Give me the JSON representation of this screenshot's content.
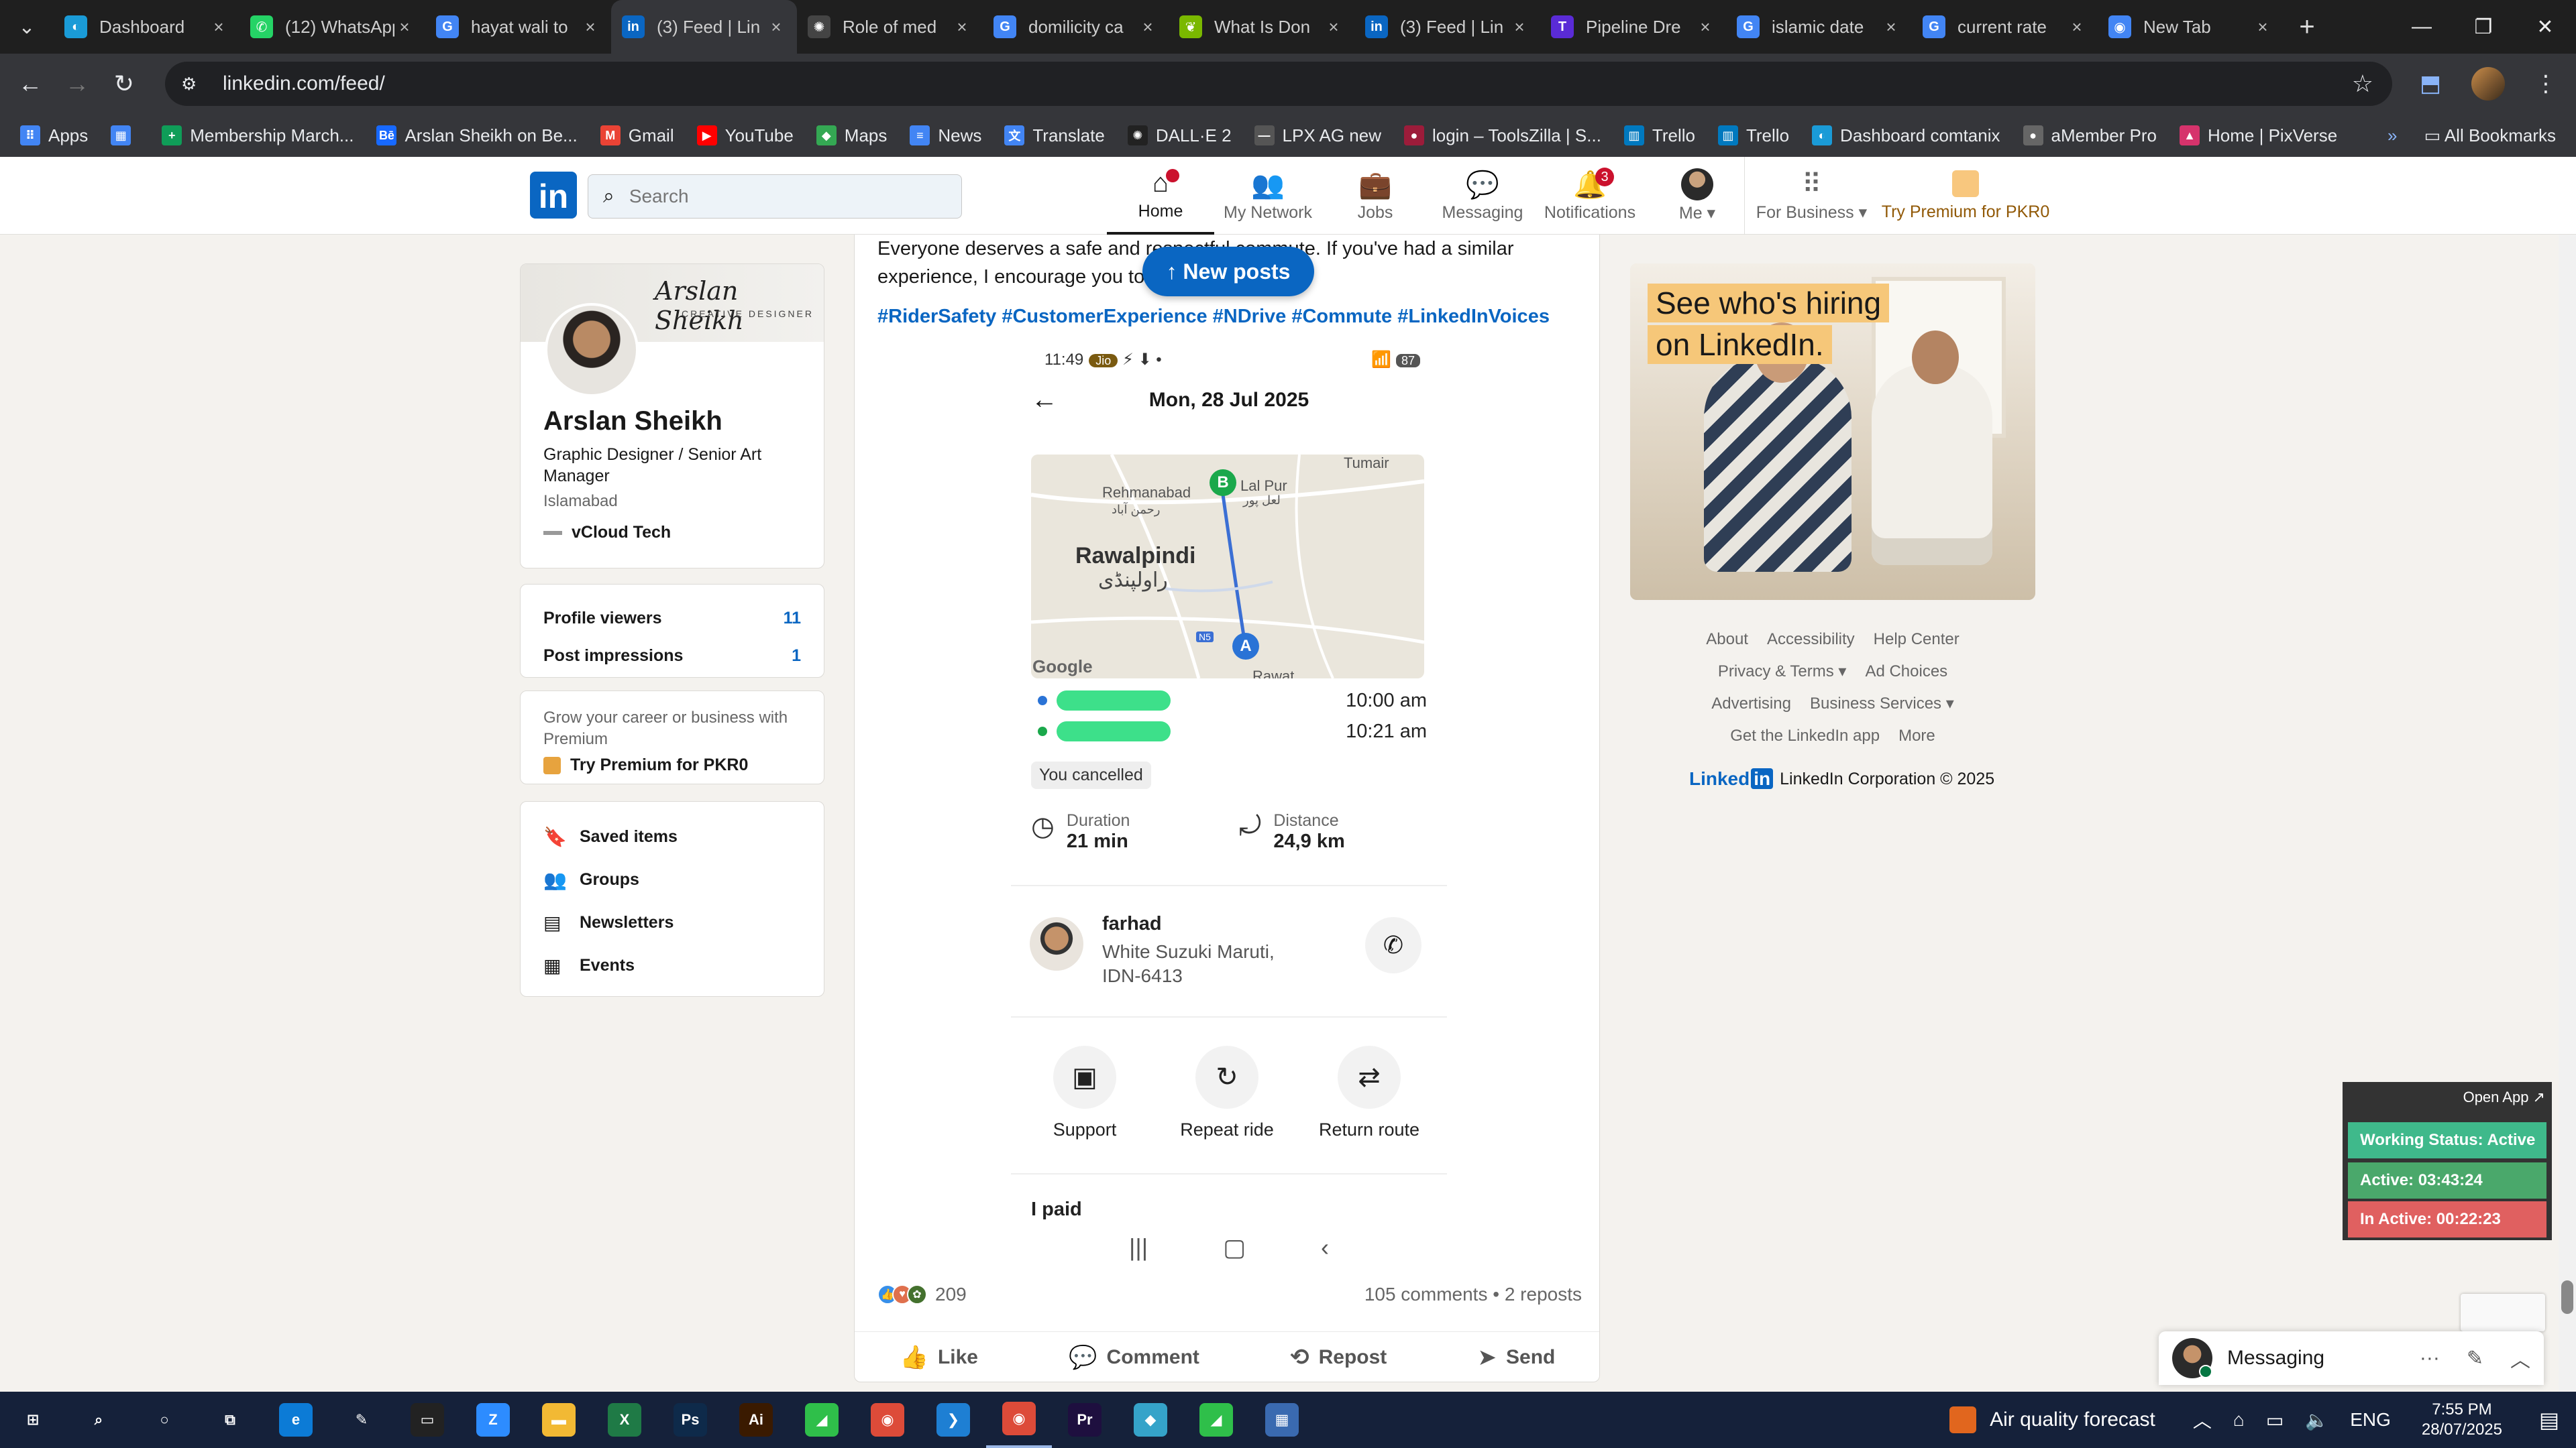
{
  "browser": {
    "tabs": [
      {
        "title": "Dashboard",
        "icon": "dashboard-icon",
        "color": "#1a9bd7",
        "glyph": "◐"
      },
      {
        "title": "(12) WhatsApp",
        "icon": "whatsapp-icon",
        "color": "#25d366",
        "glyph": "✆"
      },
      {
        "title": "hayat wali to",
        "icon": "google-icon",
        "color": "#4285f4",
        "glyph": "G"
      },
      {
        "title": "(3) Feed | Lin",
        "icon": "linkedin-icon",
        "color": "#0a66c2",
        "glyph": "in"
      },
      {
        "title": "Role of med",
        "icon": "openai-icon",
        "color": "#444444",
        "glyph": "✺"
      },
      {
        "title": "domilicity ca",
        "icon": "google-icon",
        "color": "#4285f4",
        "glyph": "G"
      },
      {
        "title": "What Is Don",
        "icon": "leaf-icon",
        "color": "#7ab800",
        "glyph": "❦"
      },
      {
        "title": "(3) Feed | Lin",
        "icon": "linkedin-icon",
        "color": "#0a66c2",
        "glyph": "in"
      },
      {
        "title": "Pipeline Dre",
        "icon": "t-brand-icon",
        "color": "#5a2bd6",
        "glyph": "T"
      },
      {
        "title": "islamic date",
        "icon": "google-icon",
        "color": "#4285f4",
        "glyph": "G"
      },
      {
        "title": "current rate",
        "icon": "google-icon",
        "color": "#4285f4",
        "glyph": "G"
      },
      {
        "title": "New Tab",
        "icon": "chrome-icon",
        "color": "#4285f4",
        "glyph": "◉"
      }
    ],
    "url": "linkedin.com/feed/",
    "bookmarks": [
      {
        "label": "Apps",
        "icon": "apps-grid-icon",
        "color": "#4285f4",
        "glyph": "⠿"
      },
      {
        "label": "",
        "icon": "tab-groups-icon",
        "color": "#4285f4",
        "glyph": "▦"
      },
      {
        "label": "Membership March...",
        "icon": "plus-doc-icon",
        "color": "#0f9d58",
        "glyph": "+"
      },
      {
        "label": "Arslan Sheikh on Be...",
        "icon": "behance-icon",
        "color": "#1769ff",
        "glyph": "Bē"
      },
      {
        "label": "Gmail",
        "icon": "gmail-icon",
        "color": "#ea4335",
        "glyph": "M"
      },
      {
        "label": "YouTube",
        "icon": "youtube-icon",
        "color": "#ff0000",
        "glyph": "▶"
      },
      {
        "label": "Maps",
        "icon": "maps-icon",
        "color": "#34a853",
        "glyph": "◆"
      },
      {
        "label": "News",
        "icon": "news-icon",
        "color": "#4285f4",
        "glyph": "≡"
      },
      {
        "label": "Translate",
        "icon": "translate-icon",
        "color": "#4285f4",
        "glyph": "文"
      },
      {
        "label": "DALL·E 2",
        "icon": "openai-icon",
        "color": "#222222",
        "glyph": "✺"
      },
      {
        "label": "LPX AG new",
        "icon": "dash-icon",
        "color": "#555555",
        "glyph": "—"
      },
      {
        "label": "login – ToolsZilla | S...",
        "icon": "toolszilla-icon",
        "color": "#9c1c3a",
        "glyph": "●"
      },
      {
        "label": "Trello",
        "icon": "trello-icon",
        "color": "#0079bf",
        "glyph": "▥"
      },
      {
        "label": "Trello",
        "icon": "trello-icon",
        "color": "#0079bf",
        "glyph": "▥"
      },
      {
        "label": "Dashboard comtanix",
        "icon": "dashboard-icon",
        "color": "#1a9bd7",
        "glyph": "◐"
      },
      {
        "label": "aMember Pro",
        "icon": "amember-icon",
        "color": "#666666",
        "glyph": "●"
      },
      {
        "label": "Home | PixVerse",
        "icon": "pixverse-icon",
        "color": "#d6336c",
        "glyph": "▲"
      }
    ],
    "all_bookmarks": "All Bookmarks"
  },
  "linkedin": {
    "search_placeholder": "Search",
    "nav": [
      {
        "label": "Home",
        "icon": "home-icon",
        "glyph": "⌂",
        "badge": "",
        "active": true
      },
      {
        "label": "My Network",
        "icon": "network-icon",
        "glyph": "👥",
        "badge": "",
        "active": false
      },
      {
        "label": "Jobs",
        "icon": "briefcase-icon",
        "glyph": "💼",
        "badge": "",
        "active": false
      },
      {
        "label": "Messaging",
        "icon": "chat-icon",
        "glyph": "💬",
        "badge": "",
        "active": false
      },
      {
        "label": "Notifications",
        "icon": "bell-icon",
        "glyph": "🔔",
        "badge": "3",
        "active": false
      }
    ],
    "me_label": "Me ▾",
    "for_business": "For Business ▾",
    "try_premium": "Try Premium for PKR0"
  },
  "profile": {
    "cover_signature": "Arslan Sheikh",
    "cover_subtitle": "CREATIVE DESIGNER",
    "name": "Arslan Sheikh",
    "headline": "Graphic Designer / Senior Art Manager",
    "location": "Islamabad",
    "company": "vCloud Tech",
    "stats": [
      {
        "label": "Profile viewers",
        "value": "11"
      },
      {
        "label": "Post impressions",
        "value": "1"
      }
    ],
    "premium_text": "Grow your career or business with Premium",
    "premium_link": "Try Premium for PKR0",
    "shortcuts": [
      {
        "label": "Saved items",
        "icon": "bookmark-icon",
        "glyph": "🔖"
      },
      {
        "label": "Groups",
        "icon": "groups-icon",
        "glyph": "👥"
      },
      {
        "label": "Newsletters",
        "icon": "newsletter-icon",
        "glyph": "▤"
      },
      {
        "label": "Events",
        "icon": "calendar-icon",
        "glyph": "▦"
      }
    ]
  },
  "post": {
    "text": "Everyone deserves a safe and respectful commute. If you've had a similar experience, I encourage you to speak up. We",
    "hashtags": "#RiderSafety #CustomerExperience #NDrive #Commute #LinkedInVoices",
    "new_posts": "↑ New posts",
    "screenshot": {
      "time": "11:49",
      "carrier": "Jio",
      "battery": "87",
      "title": "Mon, 28 Jul 2025",
      "map_city": "Rawalpindi",
      "map_city_urdu": "راولپنڈی",
      "map_labels": [
        "Rehmanabad",
        "رحمن آباد",
        "Lal Pur",
        "لعل پور",
        "Tumair",
        "Rawat",
        "N5"
      ],
      "pin_b": "B",
      "pin_a": "A",
      "google": "Google",
      "pickup_time": "10:00 am",
      "dropoff_time": "10:21 am",
      "cancel_status": "You cancelled",
      "duration_label": "Duration",
      "duration_value": "21 min",
      "distance_label": "Distance",
      "distance_value": "24,9 km",
      "driver_name": "farhad",
      "driver_car": "White Suzuki Maruti, IDN-6413",
      "actions": [
        {
          "label": "Support",
          "icon": "support-chat-icon",
          "glyph": "▣"
        },
        {
          "label": "Repeat ride",
          "icon": "repeat-icon",
          "glyph": "↻"
        },
        {
          "label": "Return route",
          "icon": "swap-icon",
          "glyph": "⇄"
        }
      ],
      "paid": "I paid"
    },
    "reactions_count": "209",
    "comments_reposts": "105 comments • 2 reposts",
    "actions": [
      {
        "label": "Like",
        "icon": "thumbs-up-icon",
        "glyph": "👍"
      },
      {
        "label": "Comment",
        "icon": "comment-icon",
        "glyph": "💬"
      },
      {
        "label": "Repost",
        "icon": "repost-icon",
        "glyph": "⟲"
      },
      {
        "label": "Send",
        "icon": "send-icon",
        "glyph": "➤"
      }
    ]
  },
  "ad": {
    "line1": "See who's hiring",
    "line2": "on LinkedIn."
  },
  "footer": {
    "links": [
      "About",
      "Accessibility",
      "Help Center",
      "Privacy & Terms ▾",
      "Ad Choices",
      "Advertising",
      "Business Services ▾",
      "Get the LinkedIn app",
      "More"
    ],
    "brand": "Linked",
    "brand_in": "in",
    "copyright": "LinkedIn Corporation © 2025"
  },
  "tracker": {
    "open_app": "Open App ↗",
    "working_status": "Working Status: Active",
    "active": "Active: 03:43:24",
    "inactive": "In Active: 00:22:23"
  },
  "messaging": {
    "title": "Messaging"
  },
  "taskbar": {
    "weather": "Air quality forecast",
    "lang": "ENG",
    "time": "7:55 PM",
    "date": "28/07/2025",
    "apps": [
      {
        "icon": "windows-start-icon",
        "glyph": "⊞",
        "color": "transparent"
      },
      {
        "icon": "search-icon",
        "glyph": "⌕",
        "color": "transparent"
      },
      {
        "icon": "cortana-icon",
        "glyph": "○",
        "color": "transparent"
      },
      {
        "icon": "task-view-icon",
        "glyph": "⧉",
        "color": "transparent"
      },
      {
        "icon": "edge-icon",
        "glyph": "e",
        "color": "#0c7bd6"
      },
      {
        "icon": "pen-icon",
        "glyph": "✎",
        "color": "transparent"
      },
      {
        "icon": "terminal-icon",
        "glyph": "▭",
        "color": "#222222"
      },
      {
        "icon": "zoom-icon",
        "glyph": "Z",
        "color": "#2d8cff"
      },
      {
        "icon": "file-explorer-icon",
        "glyph": "▬",
        "color": "#f2b934"
      },
      {
        "icon": "excel-icon",
        "glyph": "X",
        "color": "#1f7a46"
      },
      {
        "icon": "photoshop-icon",
        "glyph": "Ps",
        "color": "#0e2a4a"
      },
      {
        "icon": "illustrator-icon",
        "glyph": "Ai",
        "color": "#3a1a00"
      },
      {
        "icon": "green-app-icon",
        "glyph": "◢",
        "color": "#2fbf4a"
      },
      {
        "icon": "chrome-icon",
        "glyph": "◉",
        "color": "#dd4b39"
      },
      {
        "icon": "vscode-icon",
        "glyph": "❯",
        "color": "#1e7fd3"
      },
      {
        "icon": "chrome-icon",
        "glyph": "◉",
        "color": "#dd4b39"
      },
      {
        "icon": "premiere-icon",
        "glyph": "Pr",
        "color": "#1e0f3f"
      },
      {
        "icon": "blue-app-icon",
        "glyph": "◆",
        "color": "#35a3c9"
      },
      {
        "icon": "green-app-icon",
        "glyph": "◢",
        "color": "#2fbf4a"
      },
      {
        "icon": "calculator-icon",
        "glyph": "▦",
        "color": "#3a6ab0"
      }
    ]
  }
}
